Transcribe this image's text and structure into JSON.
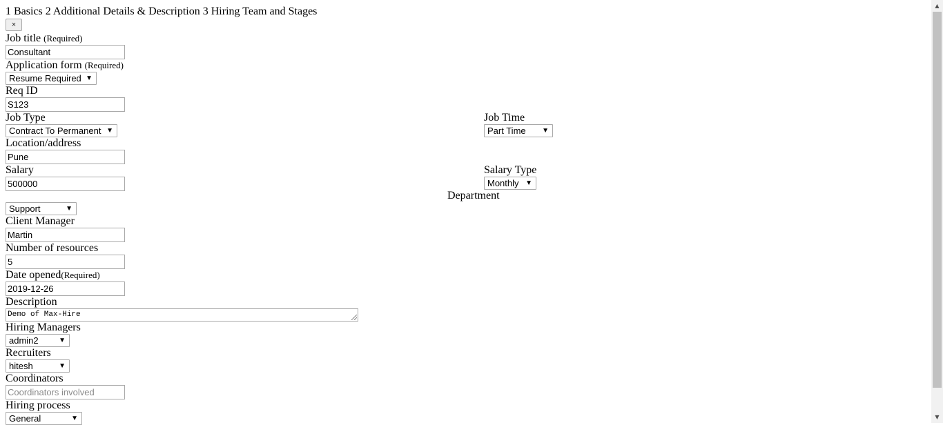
{
  "stepper": {
    "text": "1 Basics 2 Additional Details & Description 3 Hiring Team and Stages"
  },
  "close_button": {
    "label": "×"
  },
  "form": {
    "job_title": {
      "label": "Job title",
      "required": "(Required)",
      "value": "Consultant"
    },
    "application_form": {
      "label": "Application form",
      "required": "(Required)",
      "value": "Resume Required"
    },
    "req_id": {
      "label": "Req ID",
      "value": "S123"
    },
    "job_type": {
      "label": "Job Type",
      "value": "Contract To Permanent"
    },
    "job_time": {
      "label": "Job Time",
      "value": "Part Time"
    },
    "location": {
      "label": "Location/address",
      "value": "Pune"
    },
    "salary": {
      "label": "Salary",
      "value": "500000"
    },
    "salary_type": {
      "label": "Salary Type",
      "value": "Monthly"
    },
    "department": {
      "label": "Department",
      "value": "Support"
    },
    "client_manager": {
      "label": "Client Manager",
      "value": "Martin"
    },
    "resources": {
      "label": "Number of resources",
      "value": "5"
    },
    "date_opened": {
      "label": "Date opened",
      "required": "(Required)",
      "value": "2019-12-26"
    },
    "description": {
      "label": "Description",
      "value": "Demo of Max-Hire"
    },
    "hiring_managers": {
      "label": "Hiring Managers",
      "value": "admin2"
    },
    "recruiters": {
      "label": "Recruiters",
      "value": "hitesh"
    },
    "coordinators": {
      "label": "Coordinators",
      "placeholder": "Coordinators involved"
    },
    "hiring_process": {
      "label": "Hiring process",
      "value": "General"
    }
  },
  "icons": {
    "dropdown": "triangle-down-icon",
    "scroll_up": "scroll-up-icon",
    "scroll_down": "scroll-down-icon"
  },
  "colors": {
    "border": "#a9a9a9",
    "scroll_track": "#f1f1f1",
    "scroll_thumb": "#c1c1c1"
  }
}
